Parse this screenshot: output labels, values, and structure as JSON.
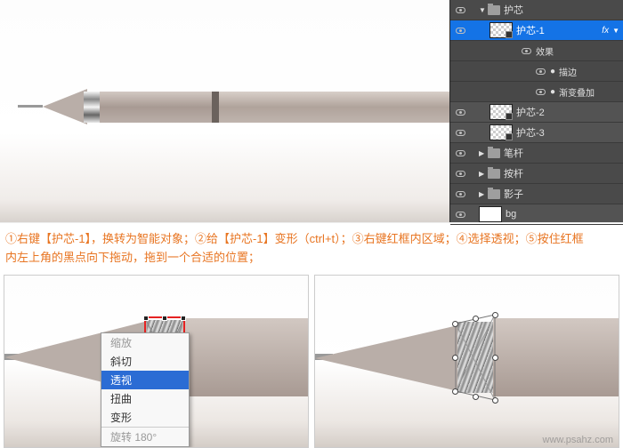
{
  "layers": {
    "group_name": "护芯",
    "selected_layer": "护芯-1",
    "fx_label": "fx",
    "effects_label": "效果",
    "effect_items": [
      "描边",
      "渐变叠加"
    ],
    "siblings": [
      "护芯-2",
      "护芯-3"
    ],
    "other_groups": [
      "笔杆",
      "按杆",
      "影子"
    ],
    "bg_layer": "bg"
  },
  "instructions": {
    "line1": "①右键【护芯-1】，换转为智能对象；②给【护芯-1】变形（ctrl+t）；③右键红框内区域；④选择透视；⑤按住红框",
    "line2": "内左上角的黑点向下拖动，拖到一个合适的位置；"
  },
  "context_menu": {
    "items": [
      {
        "label": "缩放",
        "state": "disabled"
      },
      {
        "label": "斜切",
        "state": "normal"
      },
      {
        "label": "透视",
        "state": "selected"
      },
      {
        "label": "扭曲",
        "state": "normal"
      },
      {
        "label": "变形",
        "state": "normal"
      }
    ],
    "footer": "旋转 180°"
  },
  "watermark": "www.psahz.com"
}
